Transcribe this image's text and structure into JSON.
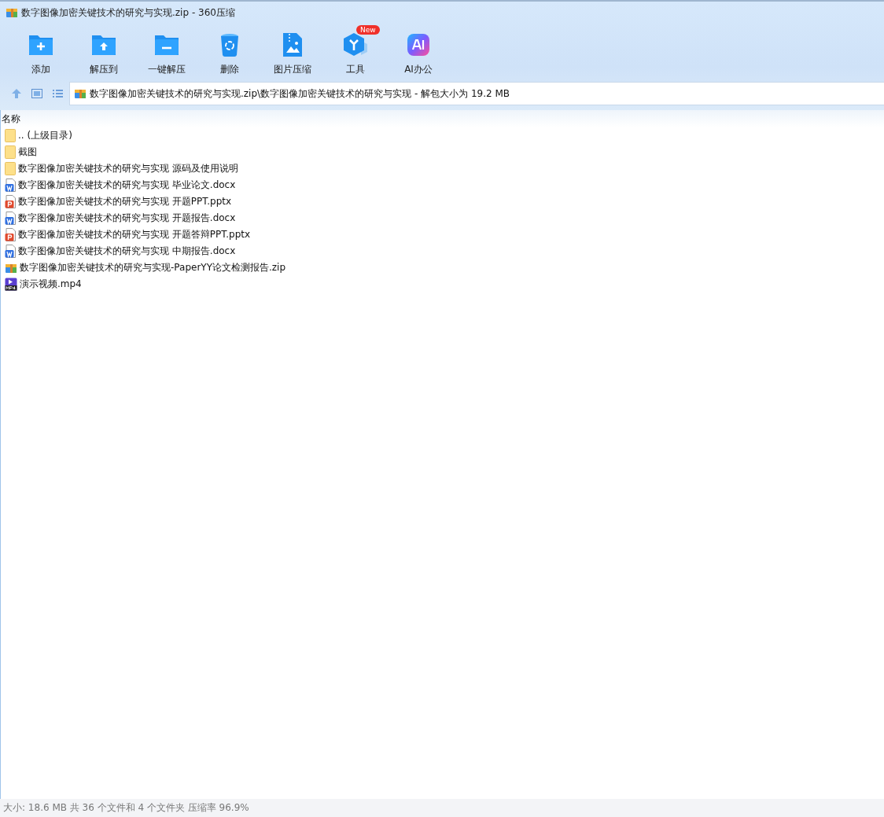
{
  "window": {
    "title": "数字图像加密关键技术的研究与实现.zip - 360压缩"
  },
  "toolbar": [
    {
      "kind": "add",
      "label": "添加"
    },
    {
      "kind": "extract",
      "label": "解压到"
    },
    {
      "kind": "oneclick",
      "label": "一键解压"
    },
    {
      "kind": "delete",
      "label": "删除"
    },
    {
      "kind": "image",
      "label": "图片压缩"
    },
    {
      "kind": "tools",
      "label": "工具",
      "badge": "New"
    },
    {
      "kind": "ai",
      "label": "AI办公"
    }
  ],
  "address": {
    "path": "数字图像加密关键技术的研究与实现.zip\\数字图像加密关键技术的研究与实现 - 解包大小为 19.2 MB"
  },
  "columns": [
    "名称"
  ],
  "files": [
    {
      "kind": "folder",
      "name": ".. (上级目录)"
    },
    {
      "kind": "folder",
      "name": "截图"
    },
    {
      "kind": "folder",
      "name": "数字图像加密关键技术的研究与实现 源码及使用说明"
    },
    {
      "kind": "word",
      "name": "数字图像加密关键技术的研究与实现 毕业论文.docx"
    },
    {
      "kind": "ppt",
      "name": "数字图像加密关键技术的研究与实现 开题PPT.pptx"
    },
    {
      "kind": "word",
      "name": "数字图像加密关键技术的研究与实现 开题报告.docx"
    },
    {
      "kind": "ppt",
      "name": "数字图像加密关键技术的研究与实现 开题答辩PPT.pptx"
    },
    {
      "kind": "word",
      "name": "数字图像加密关键技术的研究与实现 中期报告.docx"
    },
    {
      "kind": "zip",
      "name": "数字图像加密关键技术的研究与实现-PaperYY论文检测报告.zip"
    },
    {
      "kind": "video",
      "name": "演示视频.mp4"
    }
  ],
  "status_bar": "大小: 18.6 MB 共 36 个文件和 4 个文件夹 压缩率 96.9%"
}
